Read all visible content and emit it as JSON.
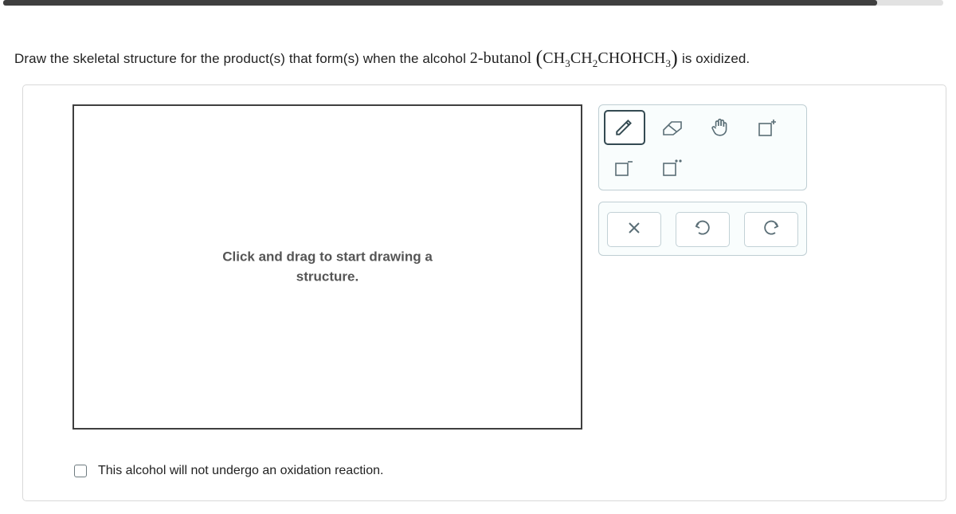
{
  "progress": {
    "percent": 93
  },
  "question": {
    "pre": "Draw the skeletal structure for the product(s) that form(s) when the alcohol ",
    "compound_name": "2-butanol",
    "formula_html": "(CH<sub>3</sub>CH<sub>2</sub>CHOHCH<sub>3</sub>)",
    "post": " is oxidized."
  },
  "canvas": {
    "hint_line1": "Click and drag to start drawing a",
    "hint_line2": "structure."
  },
  "toolbar": {
    "tools": {
      "draw": "draw-tool",
      "eraser": "eraser-tool",
      "pan": "pan-tool",
      "positive": "add-charge-positive",
      "negative": "add-charge-negative",
      "lone_pair": "add-lone-pair"
    },
    "actions": {
      "clear": "clear",
      "undo": "undo",
      "redo": "redo"
    }
  },
  "checkbox": {
    "label": "This alcohol will not undergo an oxidation reaction."
  }
}
